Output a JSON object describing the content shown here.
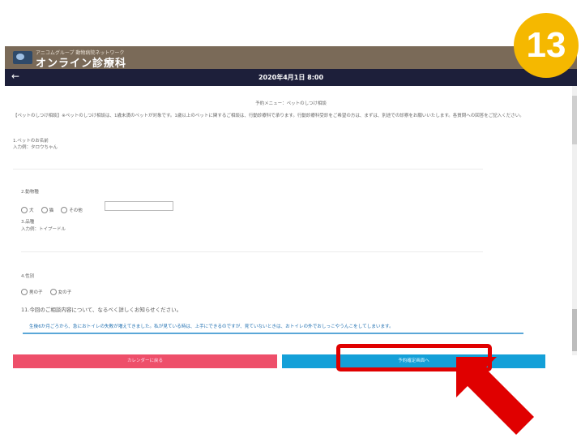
{
  "header": {
    "brand_sub": "アニコムグループ 動物病院ネットワーク",
    "brand_name": "オンライン診療科",
    "back_icon": "back-arrow-icon",
    "date": "2020年4月1日 8:00"
  },
  "form": {
    "menu_title": "予約メニュー：ペットのしつけ相談",
    "intro": "【ペットのしつけ相談】※ペットのしつけ相談は、1歳未満のペットが対象です。1歳以上のペットに関するご相談は、行動診療科で承ります。行動診療科受診をご希望の方は、まずは、別途での診察をお願いいたします。各質問への回答をご記入ください。",
    "q1_label": "1.ペットのお名前",
    "q1_example": "入力例：タロウちゃん",
    "q2_label": "2.動物種",
    "q2_options": [
      "犬",
      "猫",
      "その他"
    ],
    "q3_label": "3.品種",
    "q3_example": "入力例：トイプードル",
    "q4_label": "4.性別",
    "q4_options": [
      "男の子",
      "女の子"
    ],
    "q5_label": "11.今回のご相談内容について、なるべく詳しくお知らせください。",
    "q5_answer": "生後6か月ごろから、急におトイレの失敗が増えてきました。私が見ている時は、上手にできるのですが、見ていないときは、おトイレの外でおしっこやうんこをしてしまいます。"
  },
  "buttons": {
    "back_to_calendar": "カレンダーに戻る",
    "confirm": "予約確定画面へ"
  },
  "annotation": {
    "step_number": "13",
    "badge_color": "#f5b800",
    "highlight_color": "#e00000"
  }
}
